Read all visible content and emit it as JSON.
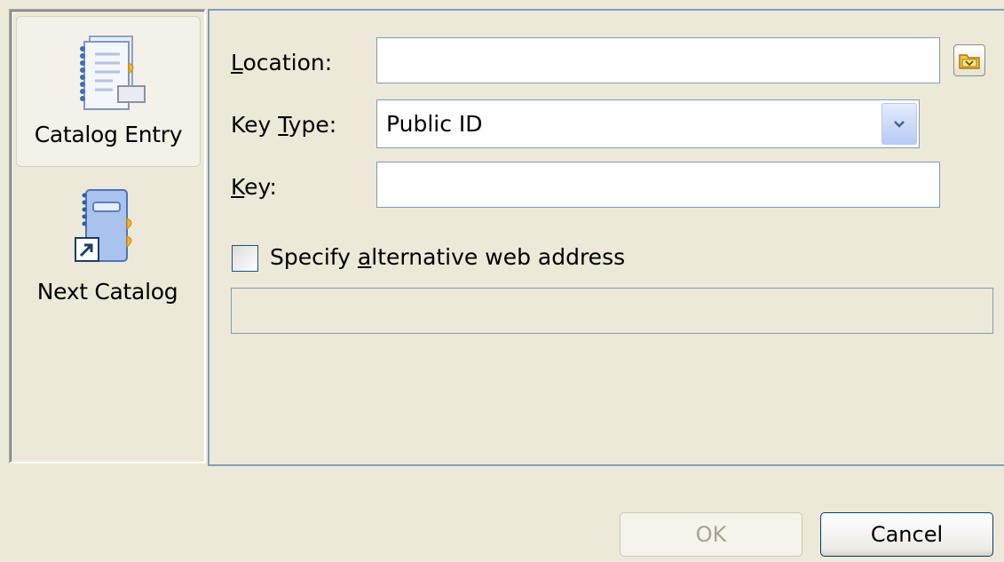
{
  "sidebar": {
    "items": [
      {
        "label": "Catalog Entry",
        "icon": "catalog-entry-icon",
        "selected": true
      },
      {
        "label": "Next Catalog",
        "icon": "next-catalog-icon",
        "selected": false
      }
    ]
  },
  "form": {
    "location": {
      "label_pre": "",
      "label_accel": "L",
      "label_post": "ocation:",
      "value": ""
    },
    "key_type": {
      "label_pre": "Key ",
      "label_accel": "T",
      "label_post": "ype:",
      "value": "Public ID"
    },
    "key": {
      "label_pre": "",
      "label_accel": "K",
      "label_post": "ey:",
      "value": ""
    },
    "alt_web": {
      "label_pre": "Specify ",
      "label_accel": "a",
      "label_post": "lternative web address",
      "checked": false,
      "value": ""
    }
  },
  "buttons": {
    "ok": "OK",
    "cancel": "Cancel"
  },
  "colors": {
    "background": "#ece9d8",
    "border_blue": "#7f9db9",
    "folder_yellow": "#f5c542"
  }
}
